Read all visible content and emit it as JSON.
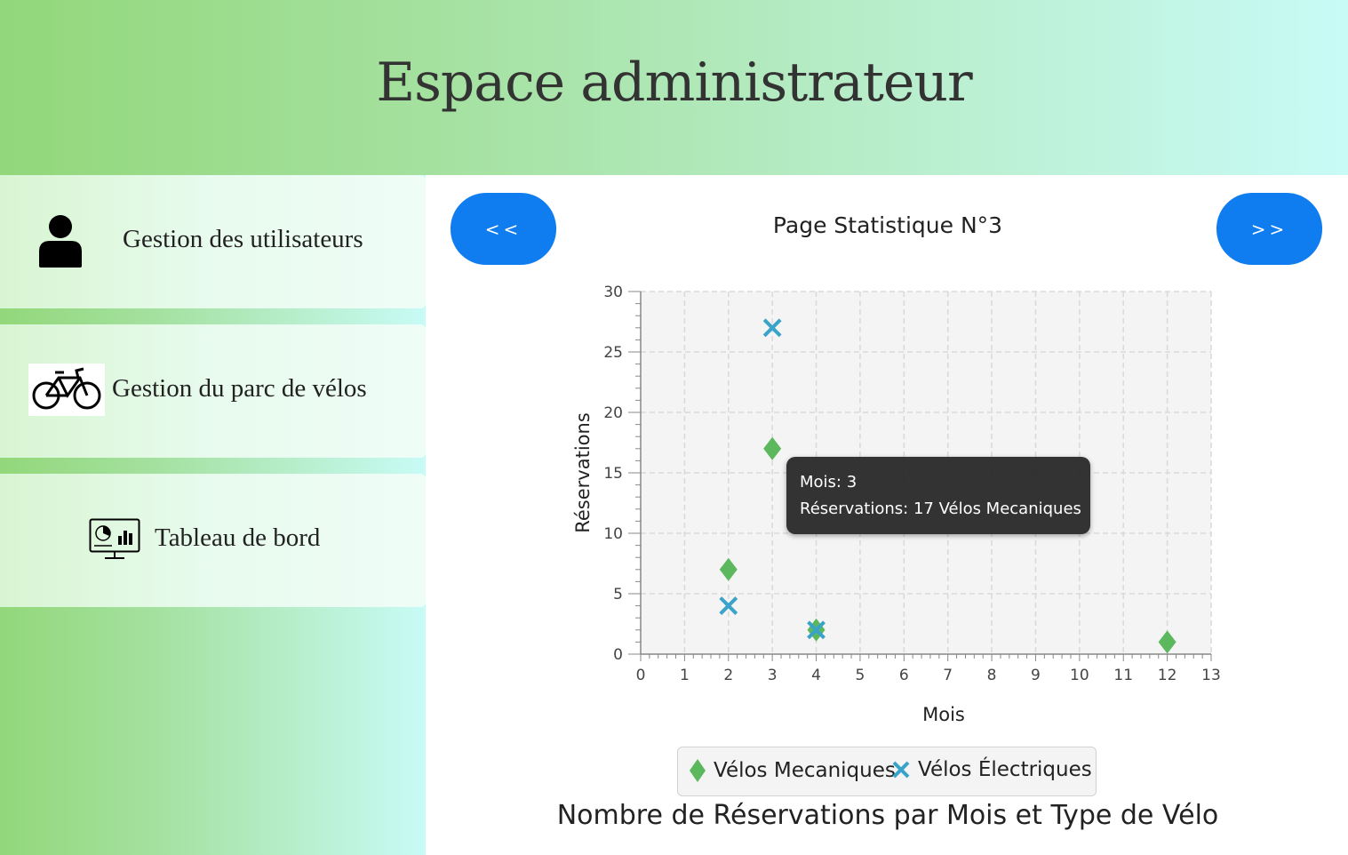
{
  "header": {
    "title": "Espace administrateur"
  },
  "sidebar": {
    "items": [
      {
        "label": "Gestion des utilisateurs",
        "icon": "user-icon"
      },
      {
        "label": "Gestion du parc de vélos",
        "icon": "bicycle-icon"
      },
      {
        "label": "Tableau de bord",
        "icon": "dashboard-monitor-icon"
      }
    ]
  },
  "main": {
    "prev_label": "<<",
    "next_label": ">>",
    "page_title": "Page Statistique N°3"
  },
  "tooltip": {
    "line1": "Mois: 3",
    "line2": "Réservations: 17 Vélos Mecaniques"
  },
  "colors": {
    "accent_blue": "#0f7cf0",
    "series_mecaniques": "#5cb85c",
    "series_electriques": "#3aa3c9",
    "plot_background": "#f4f4f4"
  },
  "chart_data": {
    "type": "scatter",
    "title": "Nombre de Réservations par Mois et Type de Vélo",
    "xlabel": "Mois",
    "ylabel": "Réservations",
    "xlim": [
      0,
      13
    ],
    "ylim": [
      0,
      30
    ],
    "xticks": [
      0,
      1,
      2,
      3,
      4,
      5,
      6,
      7,
      8,
      9,
      10,
      11,
      12,
      13
    ],
    "yticks": [
      0,
      5,
      10,
      15,
      20,
      25,
      30
    ],
    "grid": true,
    "legend_position": "bottom",
    "series": [
      {
        "name": "Vélos Mecaniques",
        "marker": "diamond",
        "color": "#5cb85c",
        "points": [
          {
            "x": 2,
            "y": 7
          },
          {
            "x": 3,
            "y": 17
          },
          {
            "x": 4,
            "y": 2
          },
          {
            "x": 12,
            "y": 1
          }
        ]
      },
      {
        "name": "Vélos Électriques",
        "marker": "cross",
        "color": "#3aa3c9",
        "points": [
          {
            "x": 2,
            "y": 4
          },
          {
            "x": 3,
            "y": 27
          },
          {
            "x": 4,
            "y": 2
          }
        ]
      }
    ]
  }
}
